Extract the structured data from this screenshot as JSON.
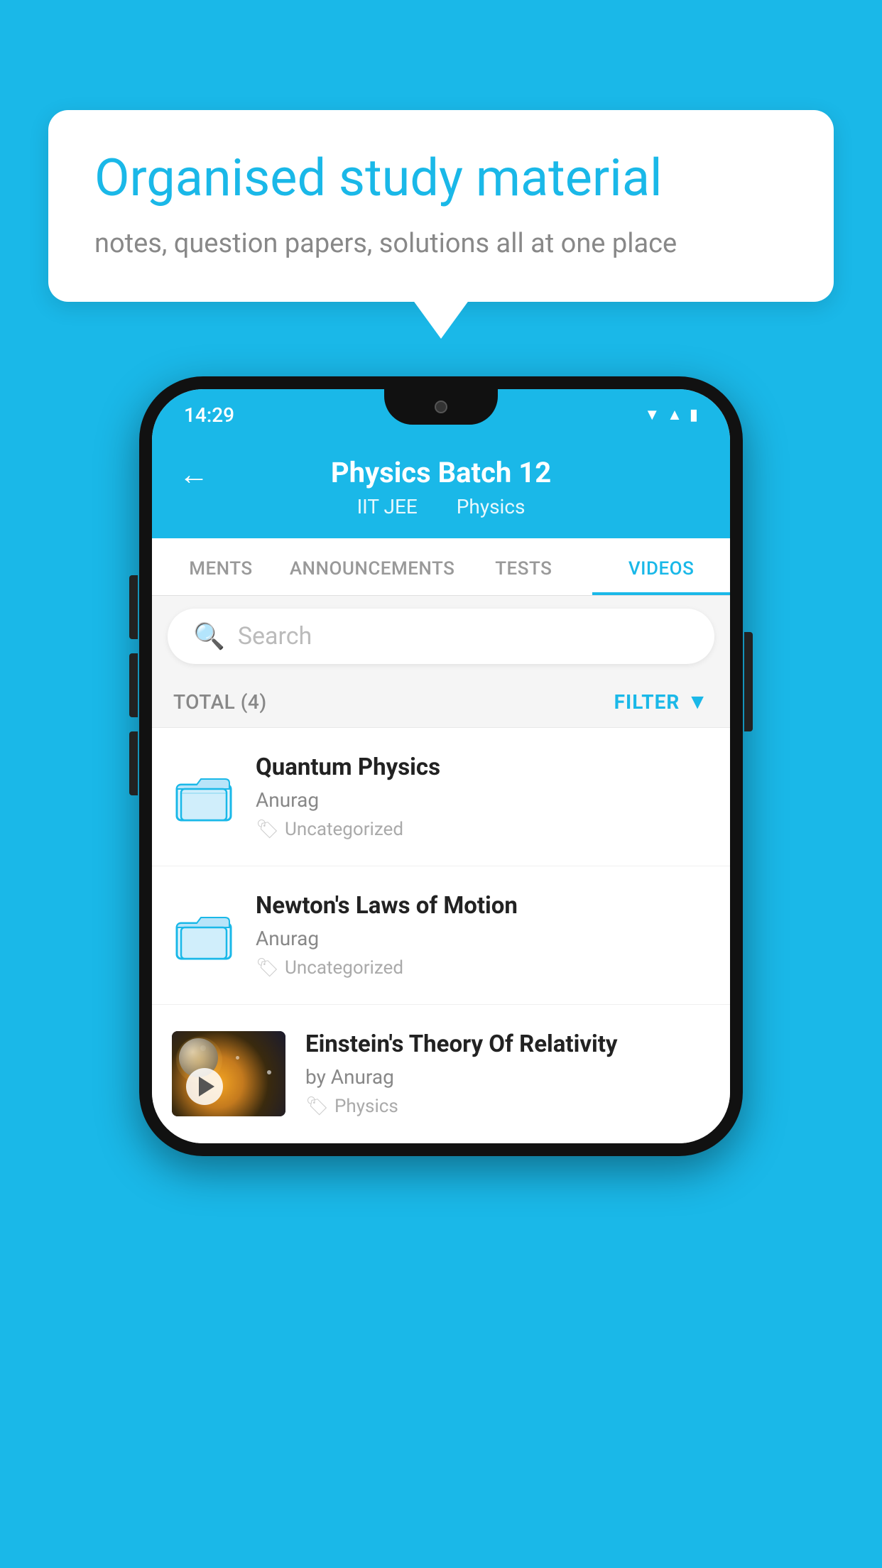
{
  "background_color": "#1ab8e8",
  "bubble": {
    "title": "Organised study material",
    "subtitle": "notes, question papers, solutions all at one place"
  },
  "status_bar": {
    "time": "14:29",
    "icons": [
      "wifi",
      "signal",
      "battery"
    ]
  },
  "app_bar": {
    "title": "Physics Batch 12",
    "subtitle_parts": [
      "IIT JEE",
      "Physics"
    ],
    "back_label": "←"
  },
  "tabs": [
    {
      "label": "MENTS",
      "active": false
    },
    {
      "label": "ANNOUNCEMENTS",
      "active": false
    },
    {
      "label": "TESTS",
      "active": false
    },
    {
      "label": "VIDEOS",
      "active": true
    }
  ],
  "search": {
    "placeholder": "Search"
  },
  "filter_bar": {
    "total_label": "TOTAL (4)",
    "filter_label": "FILTER"
  },
  "videos": [
    {
      "id": 1,
      "title": "Quantum Physics",
      "author": "Anurag",
      "tag": "Uncategorized",
      "has_thumbnail": false
    },
    {
      "id": 2,
      "title": "Newton's Laws of Motion",
      "author": "Anurag",
      "tag": "Uncategorized",
      "has_thumbnail": false
    },
    {
      "id": 3,
      "title": "Einstein's Theory Of Relativity",
      "author": "by Anurag",
      "tag": "Physics",
      "has_thumbnail": true
    }
  ]
}
